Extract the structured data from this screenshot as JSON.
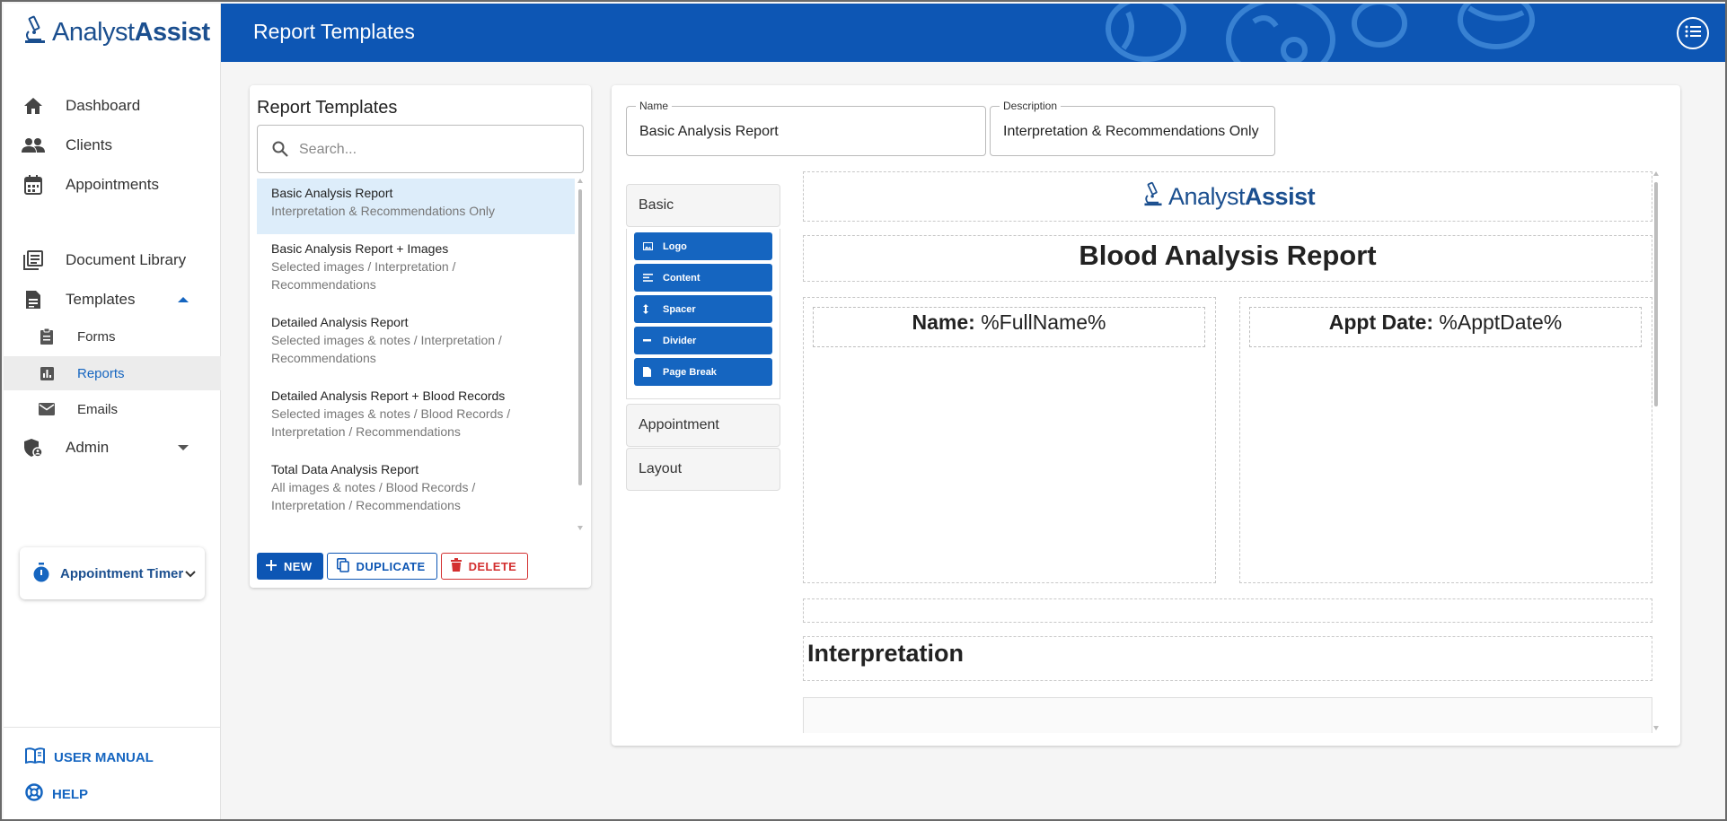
{
  "app": {
    "name_part1": "Analyst",
    "name_part2": "Assist"
  },
  "header": {
    "title": "Report Templates",
    "color": "#0d56b4"
  },
  "sidebar": {
    "nav": [
      {
        "label": "Dashboard",
        "icon": "home-icon"
      },
      {
        "label": "Clients",
        "icon": "people-icon"
      },
      {
        "label": "Appointments",
        "icon": "calendar-icon"
      },
      {
        "label": "Document Library",
        "icon": "library-icon"
      },
      {
        "label": "Templates",
        "icon": "document-icon",
        "expanded": true
      },
      {
        "label": "Admin",
        "icon": "admin-shield-icon",
        "expanded": false
      }
    ],
    "templates_sub": [
      {
        "label": "Forms",
        "icon": "clipboard-icon"
      },
      {
        "label": "Reports",
        "icon": "bar-chart-icon",
        "active": true
      },
      {
        "label": "Emails",
        "icon": "envelope-icon"
      }
    ],
    "timer_label": "Appointment Timer",
    "user_manual": "USER MANUAL",
    "help": "HELP"
  },
  "templates_panel": {
    "heading": "Report Templates",
    "search_placeholder": "Search...",
    "items": [
      {
        "title": "Basic Analysis Report",
        "lines": [
          "Interpretation & Recommendations Only"
        ],
        "selected": true
      },
      {
        "title": "Basic Analysis Report + Images",
        "lines": [
          "Selected images / Interpretation /",
          "Recommendations"
        ]
      },
      {
        "title": "Detailed Analysis Report",
        "lines": [
          "Selected images & notes / Interpretation /",
          "Recommendations"
        ]
      },
      {
        "title": "Detailed Analysis Report + Blood Records",
        "lines": [
          "Selected images & notes / Blood Records /",
          "Interpretation / Recommendations"
        ]
      },
      {
        "title": "Total Data Analysis Report",
        "lines": [
          "All images & notes / Blood Records /",
          "Interpretation / Recommendations"
        ]
      }
    ],
    "buttons": {
      "new": "NEW",
      "duplicate": "DUPLICATE",
      "delete": "DELETE"
    }
  },
  "editor": {
    "name_label": "Name",
    "name_value": "Basic Analysis Report",
    "description_label": "Description",
    "description_value": "Interpretation & Recommendations Only",
    "sections": {
      "basic": "Basic",
      "appointment": "Appointment",
      "layout": "Layout"
    },
    "tools": [
      {
        "label": "Logo",
        "icon": "image-icon"
      },
      {
        "label": "Content",
        "icon": "text-lines-icon"
      },
      {
        "label": "Spacer",
        "icon": "vertical-arrows-icon"
      },
      {
        "label": "Divider",
        "icon": "minus-icon"
      },
      {
        "label": "Page Break",
        "icon": "page-icon"
      }
    ],
    "canvas": {
      "title": "Blood Analysis Report",
      "name_field_label": "Name:",
      "name_field_value": "%FullName%",
      "appt_field_label": "Appt Date:",
      "appt_field_value": "%ApptDate%",
      "interpretation": "Interpretation"
    }
  }
}
